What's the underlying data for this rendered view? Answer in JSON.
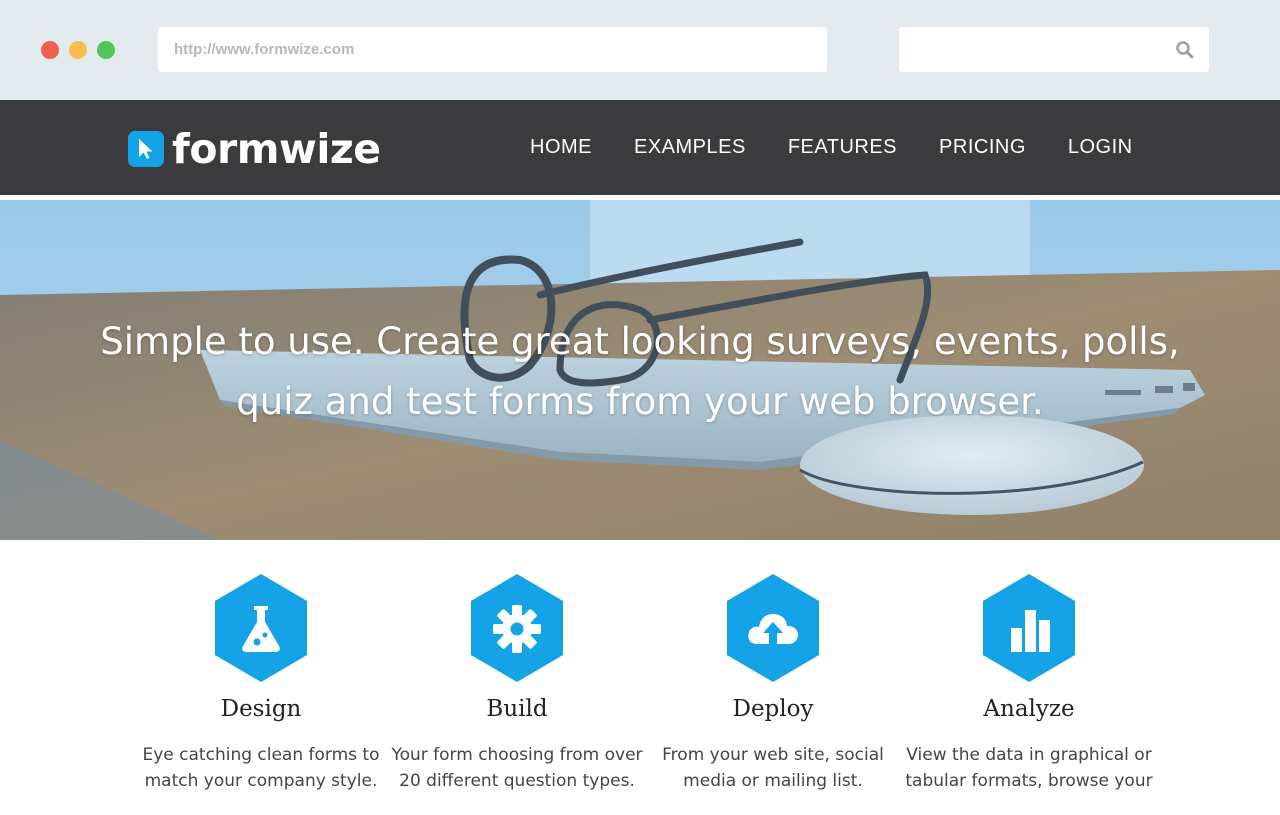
{
  "browser": {
    "url": "http://www.formwize.com",
    "search_placeholder": ""
  },
  "site": {
    "logo_text": "formwize",
    "brand_color": "#13a3e6",
    "nav_background": "#3b3b3d",
    "menu": [
      {
        "label": "HOME",
        "active": true
      },
      {
        "label": "EXAMPLES",
        "active": false
      },
      {
        "label": "FEATURES",
        "active": false
      },
      {
        "label": "PRICING",
        "active": false
      },
      {
        "label": "LOGIN",
        "active": false
      }
    ]
  },
  "hero": {
    "line1": "Simple to use. Create great looking surveys, events, polls,",
    "line2": "quiz and test forms from your web browser."
  },
  "features": [
    {
      "icon": "flask-icon",
      "title": "Design",
      "desc_line1": "Eye catching clean forms to",
      "desc_line2": "match your company style."
    },
    {
      "icon": "gear-icon",
      "title": "Build",
      "desc_line1": "Your form choosing from over",
      "desc_line2": "20 different question types."
    },
    {
      "icon": "cloud-upload-icon",
      "title": "Deploy",
      "desc_line1": "From your web site, social",
      "desc_line2": "media or mailing list."
    },
    {
      "icon": "bar-chart-icon",
      "title": "Analyze",
      "desc_line1": "View the data in graphical or",
      "desc_line2": "tabular formats, browse your"
    }
  ]
}
